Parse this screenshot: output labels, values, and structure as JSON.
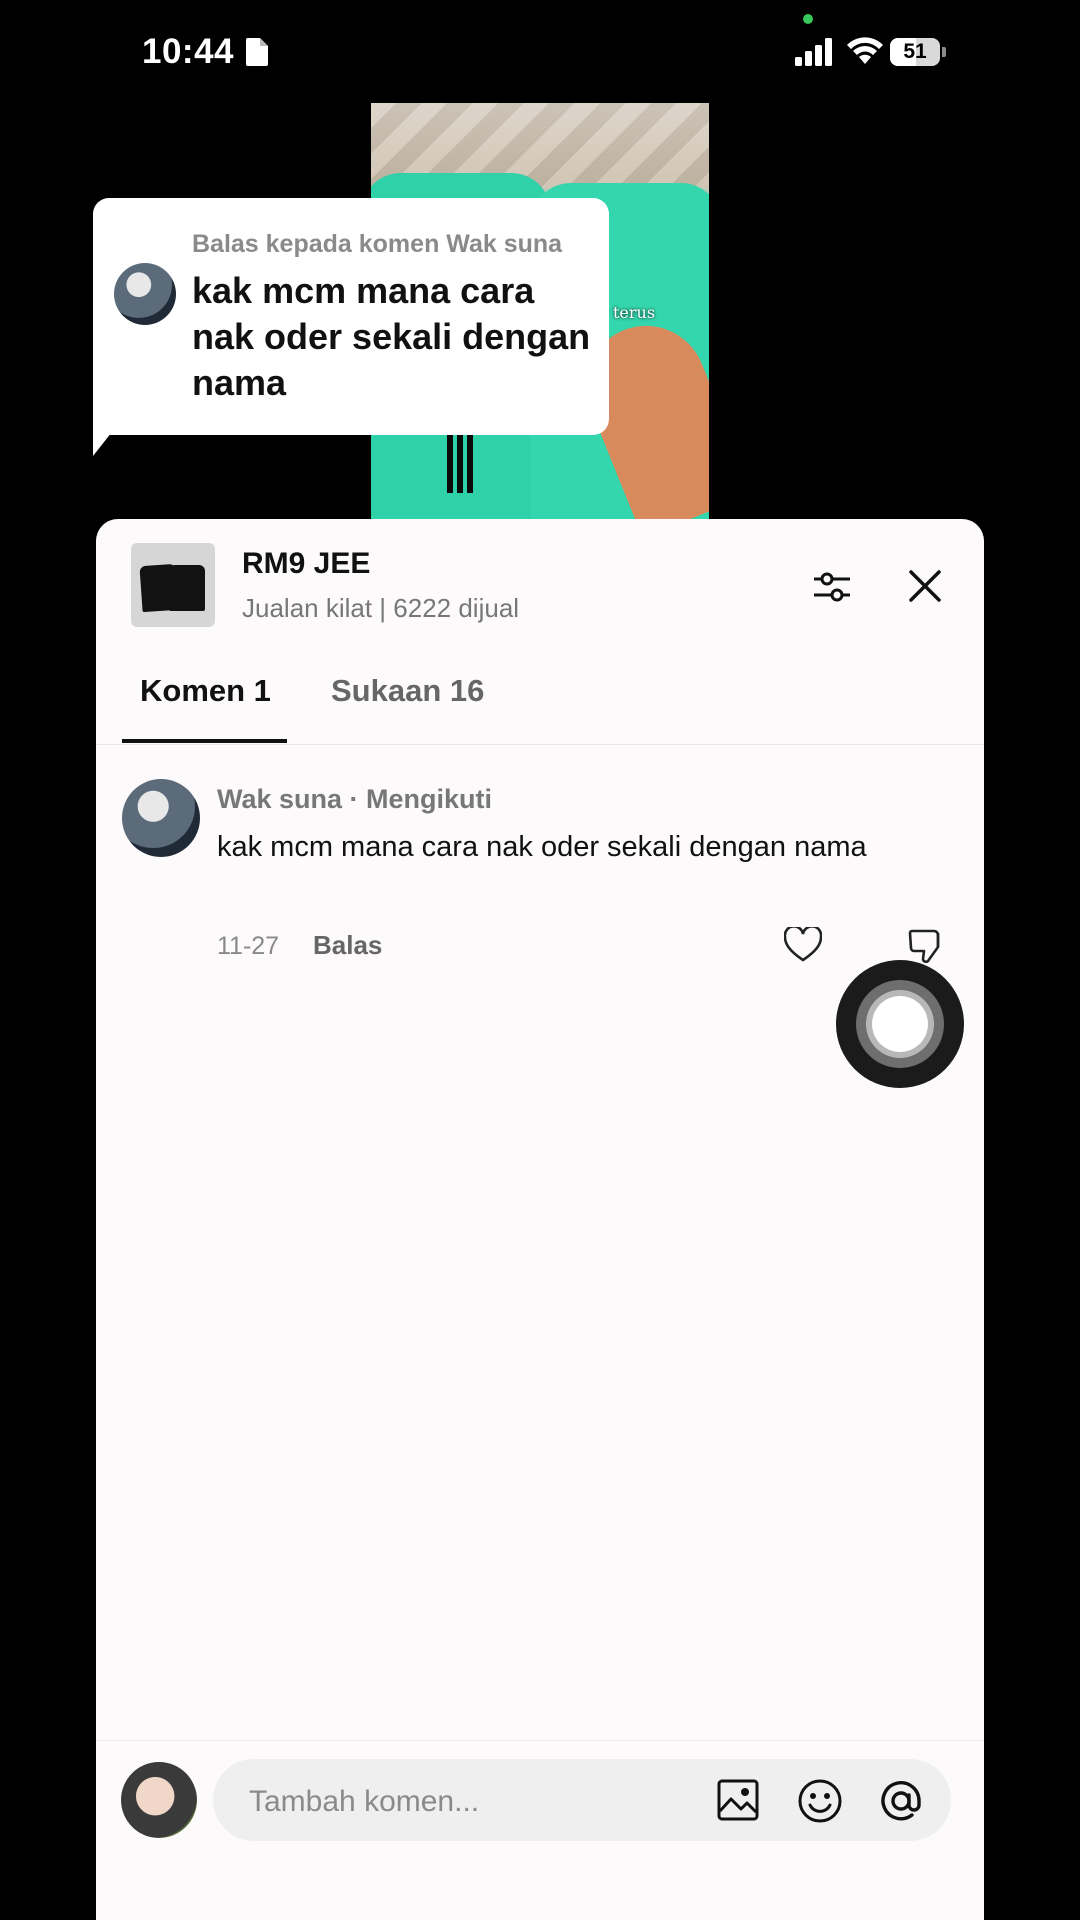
{
  "status_bar": {
    "time": "10:44",
    "battery": "51"
  },
  "video": {
    "caption": "terus\nI ̱`”"
  },
  "reply_bubble": {
    "header": "Balas kepada komen Wak suna",
    "text": "kak mcm mana cara nak oder sekali dengan nama"
  },
  "product": {
    "title": "RM9 JEE",
    "subtitle": "Jualan kilat | 6222 dijual"
  },
  "tabs": [
    {
      "label": "Komen 1",
      "active": true
    },
    {
      "label": "Sukaan 16",
      "active": false
    }
  ],
  "comment": {
    "meta": "Wak suna · Mengikuti",
    "text": "kak mcm mana cara nak oder sekali dengan nama",
    "date": "11-27",
    "reply_label": "Balas"
  },
  "input": {
    "placeholder": "Tambah komen..."
  },
  "colors": {
    "accent_green": "#2fd1a8",
    "sheet_bg": "#fdfafb"
  },
  "icons": [
    "document-icon",
    "signal-icon",
    "wifi-icon",
    "filter-icon",
    "close-icon",
    "heart-icon",
    "dislike-icon",
    "image-icon",
    "emoji-icon",
    "at-icon"
  ]
}
